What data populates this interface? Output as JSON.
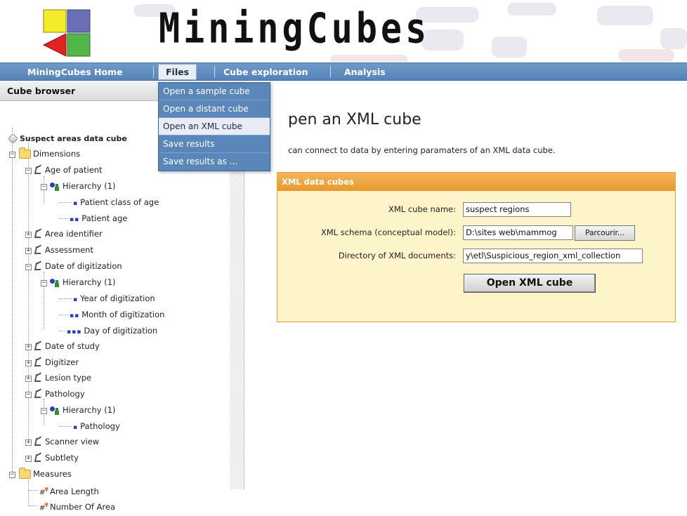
{
  "brand": {
    "name": "MiningCubes"
  },
  "colors": {
    "menubar": "#5784b8",
    "panel_header": "#e89b2e",
    "panel_body": "#fdf4c9",
    "dropdown": "#5a86ba"
  },
  "menu": {
    "items": [
      {
        "label": "MiningCubes Home"
      },
      {
        "label": "Files"
      },
      {
        "label": "Cube exploration"
      },
      {
        "label": "Analysis"
      }
    ]
  },
  "files_menu": {
    "items": [
      {
        "label": "Open a sample cube"
      },
      {
        "label": "Open a distant cube"
      },
      {
        "label": "Open an XML cube"
      },
      {
        "label": "Save results"
      },
      {
        "label": "Save results as ..."
      }
    ]
  },
  "sidebar": {
    "title": "Cube browser",
    "tree": [
      {
        "label": "Suspect areas data cube",
        "icon": "cube-icon"
      },
      {
        "label": "Dimensions",
        "icon": "folder-icon"
      },
      {
        "label": "Age of patient",
        "icon": "dimension-icon"
      },
      {
        "label": "Hierarchy (1)",
        "icon": "hierarchy-icon"
      },
      {
        "label": "Patient class of age",
        "icon": "level-1-icon",
        "dots": "▪"
      },
      {
        "label": "Patient age",
        "icon": "level-2-icon",
        "dots": "▪▪"
      },
      {
        "label": "Area identifier",
        "icon": "dimension-icon"
      },
      {
        "label": "Assessment",
        "icon": "dimension-icon"
      },
      {
        "label": "Date of digitization",
        "icon": "dimension-icon"
      },
      {
        "label": "Hierarchy (1)",
        "icon": "hierarchy-icon"
      },
      {
        "label": "Year of digitization",
        "icon": "level-1-icon",
        "dots": "▪"
      },
      {
        "label": "Month of digitization",
        "icon": "level-2-icon",
        "dots": "▪▪"
      },
      {
        "label": "Day of digitization",
        "icon": "level-3-icon",
        "dots": "▪▪▪"
      },
      {
        "label": "Date of study",
        "icon": "dimension-icon"
      },
      {
        "label": "Digitizer",
        "icon": "dimension-icon"
      },
      {
        "label": "Lesion type",
        "icon": "dimension-icon"
      },
      {
        "label": "Pathology",
        "icon": "dimension-icon"
      },
      {
        "label": "Hierarchy (1)",
        "icon": "hierarchy-icon"
      },
      {
        "label": "Pathology",
        "icon": "level-1-icon",
        "dots": "▪"
      },
      {
        "label": "Scanner view",
        "icon": "dimension-icon"
      },
      {
        "label": "Subtlety",
        "icon": "dimension-icon"
      },
      {
        "label": "Measures",
        "icon": "folder-icon"
      },
      {
        "label": "Area Length",
        "icon": "measure-icon"
      },
      {
        "label": "Number Of Area",
        "icon": "measure-icon"
      }
    ]
  },
  "main": {
    "title": "Open an XML cube",
    "title_visible": "pen an XML cube",
    "description_visible": "can connect to data by entering paramaters of an XML data cube.",
    "panel": {
      "header": "XML data cubes",
      "fields": {
        "cube_name": {
          "label": "XML cube name:",
          "value": "suspect regions"
        },
        "schema": {
          "label": "XML schema (conceptual model):",
          "value": "D:\\sites web\\mammog",
          "button": "Parcourir..."
        },
        "directory": {
          "label": "Directory of XML documents:",
          "value": "y\\etl\\Suspicious_region_xml_collection"
        }
      },
      "submit": "Open XML cube"
    }
  }
}
